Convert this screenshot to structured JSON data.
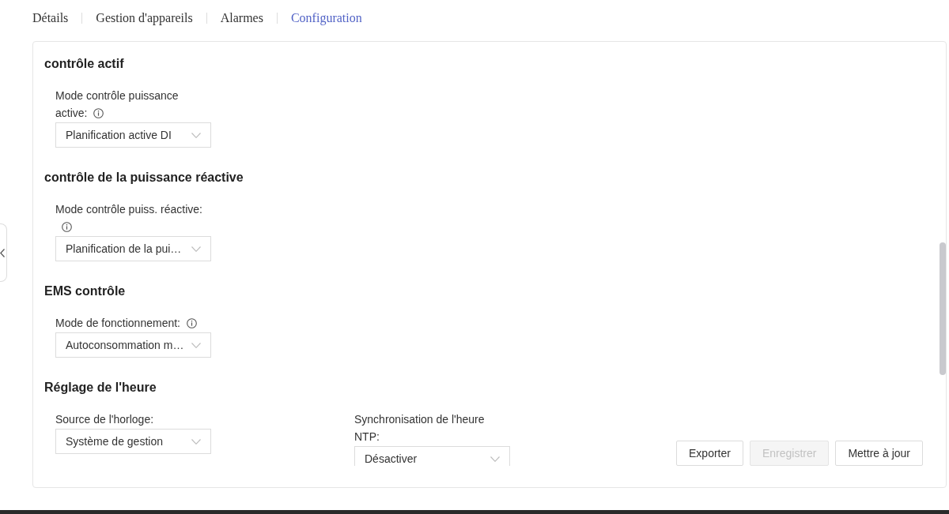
{
  "tabs": [
    {
      "label": "Détails",
      "selected": false
    },
    {
      "label": "Gestion d'appareils",
      "selected": false
    },
    {
      "label": "Alarmes",
      "selected": false
    },
    {
      "label": "Configuration",
      "selected": true
    }
  ],
  "sections": [
    {
      "title": "contrôle actif",
      "fields": [
        {
          "label": "Mode contrôle puissance active:",
          "info": true,
          "value": "Planification active DI"
        }
      ]
    },
    {
      "title": "contrôle de la puissance réactive",
      "fields": [
        {
          "label": "Mode contrôle puiss. réactive:",
          "info": true,
          "value": "Planification de la pui…"
        }
      ]
    },
    {
      "title": "EMS contrôle",
      "fields": [
        {
          "label": "Mode de fonctionnement:",
          "info": true,
          "value": "Autoconsommation m…"
        }
      ]
    },
    {
      "title": "Réglage de l'heure",
      "fields": [
        {
          "label": "Source de l'horloge:",
          "info": false,
          "value": "Système de gestion"
        },
        {
          "label": "Synchronisation de l'heure NTP:",
          "info": false,
          "value": "Désactiver"
        }
      ]
    }
  ],
  "buttons": [
    {
      "label": "Exporter",
      "disabled": false
    },
    {
      "label": "Enregistrer",
      "disabled": true
    },
    {
      "label": "Mettre à jour",
      "disabled": false
    }
  ]
}
